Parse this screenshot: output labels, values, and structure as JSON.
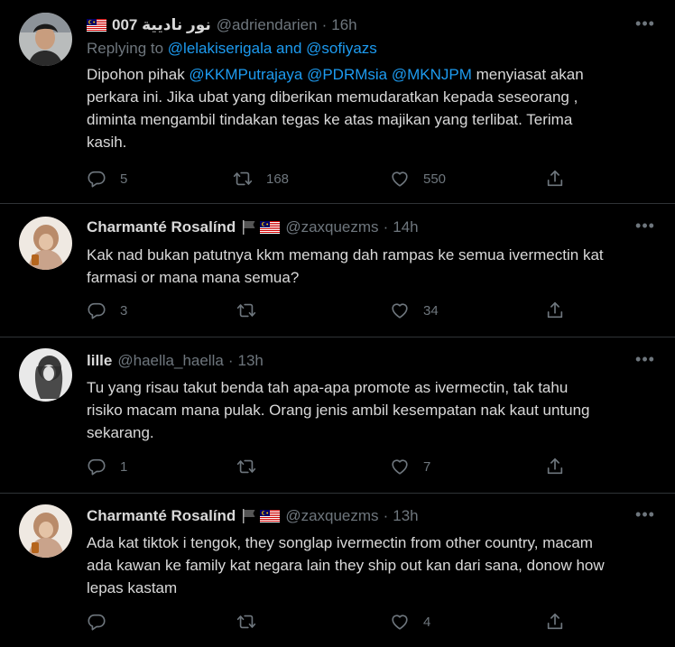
{
  "colors": {
    "background": "#000000",
    "text": "#d9d9d9",
    "muted": "#6e767d",
    "link": "#1d9bf0",
    "divider": "#2f3336"
  },
  "tweets": [
    {
      "name": "نور ناديية 007",
      "flag": "malaysia-flag-icon",
      "handle": "@adriendarien",
      "sep": "·",
      "time": "16h",
      "replying_prefix": "Replying to ",
      "replying_to": "@lelakiserigala and @sofiyazs",
      "text_lines": [
        {
          "before": "Dipohon pihak ",
          "m1": "@KKMPutrajaya",
          "m2": "@PDRMsia",
          "m3": "@MKNJPM",
          "after": " menyiasat akan"
        },
        "perkara ini. Jika ubat yang diberikan memudaratkan kepada seseorang ,",
        "diminta mengambil tindakan tegas ke atas majikan yang terlibat. Terima",
        "kasih."
      ],
      "replies": "5",
      "retweets": "168",
      "likes": "550"
    },
    {
      "name": "Charmanté Rosalínd",
      "flag": "malaysia-flag-icon",
      "handle": "@zaxquezms",
      "sep": "·",
      "time": "14h",
      "text_lines": [
        "Kak nad bukan patutnya kkm memang dah rampas ke semua ivermectin kat",
        "farmasi or mana mana semua?"
      ],
      "replies": "3",
      "retweets": "",
      "likes": "34"
    },
    {
      "name": "lille",
      "handle": "@haella_haella",
      "sep": "·",
      "time": "13h",
      "text_lines": [
        "Tu yang risau takut benda tah apa-apa promote as ivermectin, tak tahu",
        "risiko macam mana pulak. Orang jenis ambil kesempatan nak kaut untung",
        "sekarang."
      ],
      "replies": "1",
      "retweets": "",
      "likes": "7"
    },
    {
      "name": "Charmanté Rosalínd",
      "flag": "malaysia-flag-icon",
      "handle": "@zaxquezms",
      "sep": "·",
      "time": "13h",
      "text_lines": [
        "Ada kat tiktok i tengok, they songlap ivermectin from other country, macam",
        "ada kawan ke family kat negara lain they ship out kan dari sana, donow how",
        "lepas kastam"
      ],
      "replies": "",
      "retweets": "",
      "likes": "4"
    }
  ]
}
